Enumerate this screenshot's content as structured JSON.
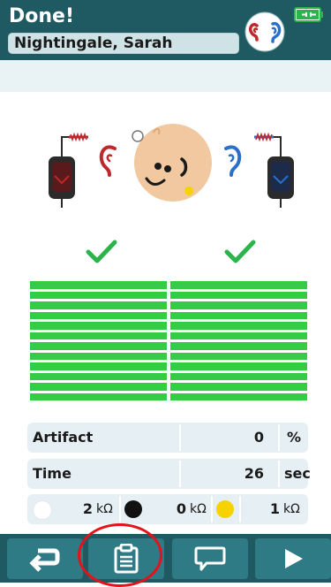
{
  "header": {
    "status_title": "Done!",
    "patient_name": "Nightingale, Sarah"
  },
  "results": {
    "left_ear": {
      "status": "pass",
      "bar_count": 12
    },
    "right_ear": {
      "status": "pass",
      "bar_count": 12
    }
  },
  "measurements": {
    "artifact": {
      "label": "Artifact",
      "value": "0",
      "unit": "%"
    },
    "time": {
      "label": "Time",
      "value": "26",
      "unit": "sec"
    },
    "impedance": [
      {
        "electrode": "white",
        "value": "2",
        "unit": "kΩ"
      },
      {
        "electrode": "black",
        "value": "0",
        "unit": "kΩ"
      },
      {
        "electrode": "yellow",
        "value": "1",
        "unit": "kΩ"
      }
    ]
  },
  "colors": {
    "header": "#1f5a63",
    "button": "#2e7a85",
    "pass_green": "#33cc44",
    "left_ear_red": "#c0272d",
    "right_ear_blue": "#2a6fc9",
    "electrode_yellow": "#f5d200",
    "highlight_red": "#e3121b"
  },
  "toolbar": {
    "buttons": [
      {
        "icon": "return-icon"
      },
      {
        "icon": "clipboard-icon"
      },
      {
        "icon": "comment-icon"
      },
      {
        "icon": "play-icon"
      }
    ]
  }
}
